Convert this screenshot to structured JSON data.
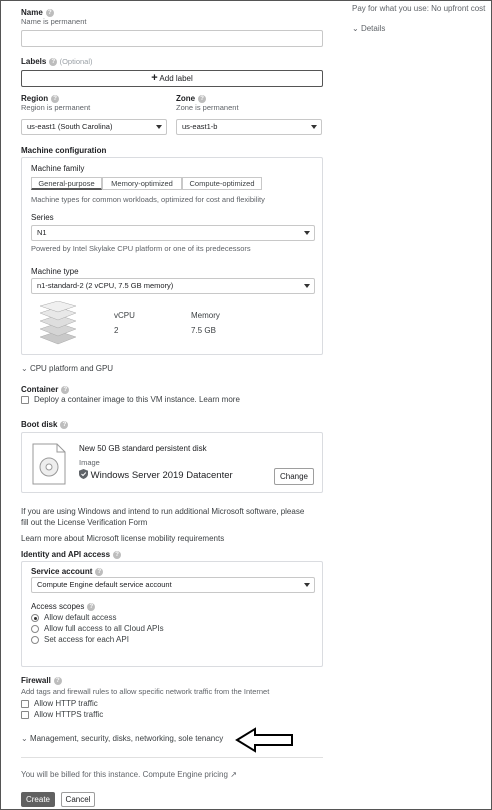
{
  "name": {
    "label": "Name",
    "hint": "Name is permanent",
    "value": ""
  },
  "labels": {
    "label": "Labels",
    "optional": "(Optional)",
    "add_button": "Add label"
  },
  "region": {
    "label": "Region",
    "hint": "Region is permanent",
    "value": "us-east1 (South Carolina)"
  },
  "zone": {
    "label": "Zone",
    "hint": "Zone is permanent",
    "value": "us-east1-b"
  },
  "machine": {
    "section_label": "Machine configuration",
    "family_label": "Machine family",
    "tabs": [
      "General-purpose",
      "Memory-optimized",
      "Compute-optimized"
    ],
    "family_desc": "Machine types for common workloads, optimized for cost and flexibility",
    "series_label": "Series",
    "series_value": "N1",
    "series_desc": "Powered by Intel Skylake CPU platform or one of its predecessors",
    "type_label": "Machine type",
    "type_value": "n1-standard-2 (2 vCPU, 7.5 GB memory)",
    "vcpu_label": "vCPU",
    "vcpu_value": "2",
    "memory_label": "Memory",
    "memory_value": "7.5 GB"
  },
  "cpu_platform": {
    "label": "CPU platform and GPU"
  },
  "container": {
    "label": "Container",
    "checkbox_text": "Deploy a container image to this VM instance.",
    "learn_more": "Learn more"
  },
  "boot_disk": {
    "label": "Boot disk",
    "disk_title": "New 50 GB standard persistent disk",
    "image_label": "Image",
    "image_name": "Windows Server 2019 Datacenter",
    "change_button": "Change"
  },
  "windows_note": {
    "line1": "If you are using Windows and intend to run additional Microsoft software, please",
    "line2": "fill out the License Verification Form",
    "learn_more": "Learn more about Microsoft license mobility requirements"
  },
  "identity": {
    "label": "Identity and API access",
    "service_account_label": "Service account",
    "service_account_value": "Compute Engine default service account",
    "scopes_label": "Access scopes",
    "scopes": [
      "Allow default access",
      "Allow full access to all Cloud APIs",
      "Set access for each API"
    ],
    "selected_scope": 0
  },
  "firewall": {
    "label": "Firewall",
    "hint": "Add tags and firewall rules to allow specific network traffic from the Internet",
    "options": [
      "Allow HTTP traffic",
      "Allow HTTPS traffic"
    ]
  },
  "management": {
    "label": "Management, security, disks, networking, sole tenancy"
  },
  "billing": {
    "text": "You will be billed for this instance.",
    "link": "Compute Engine pricing"
  },
  "actions": {
    "create": "Create",
    "cancel": "Cancel"
  },
  "side": {
    "pricing_text": "Pay for what you use: No upfront cost",
    "details": "Details"
  },
  "icons": {
    "help": "help-icon",
    "plus": "plus-icon",
    "chevron": "chevron-icon",
    "arrow": "arrow-annotation"
  }
}
